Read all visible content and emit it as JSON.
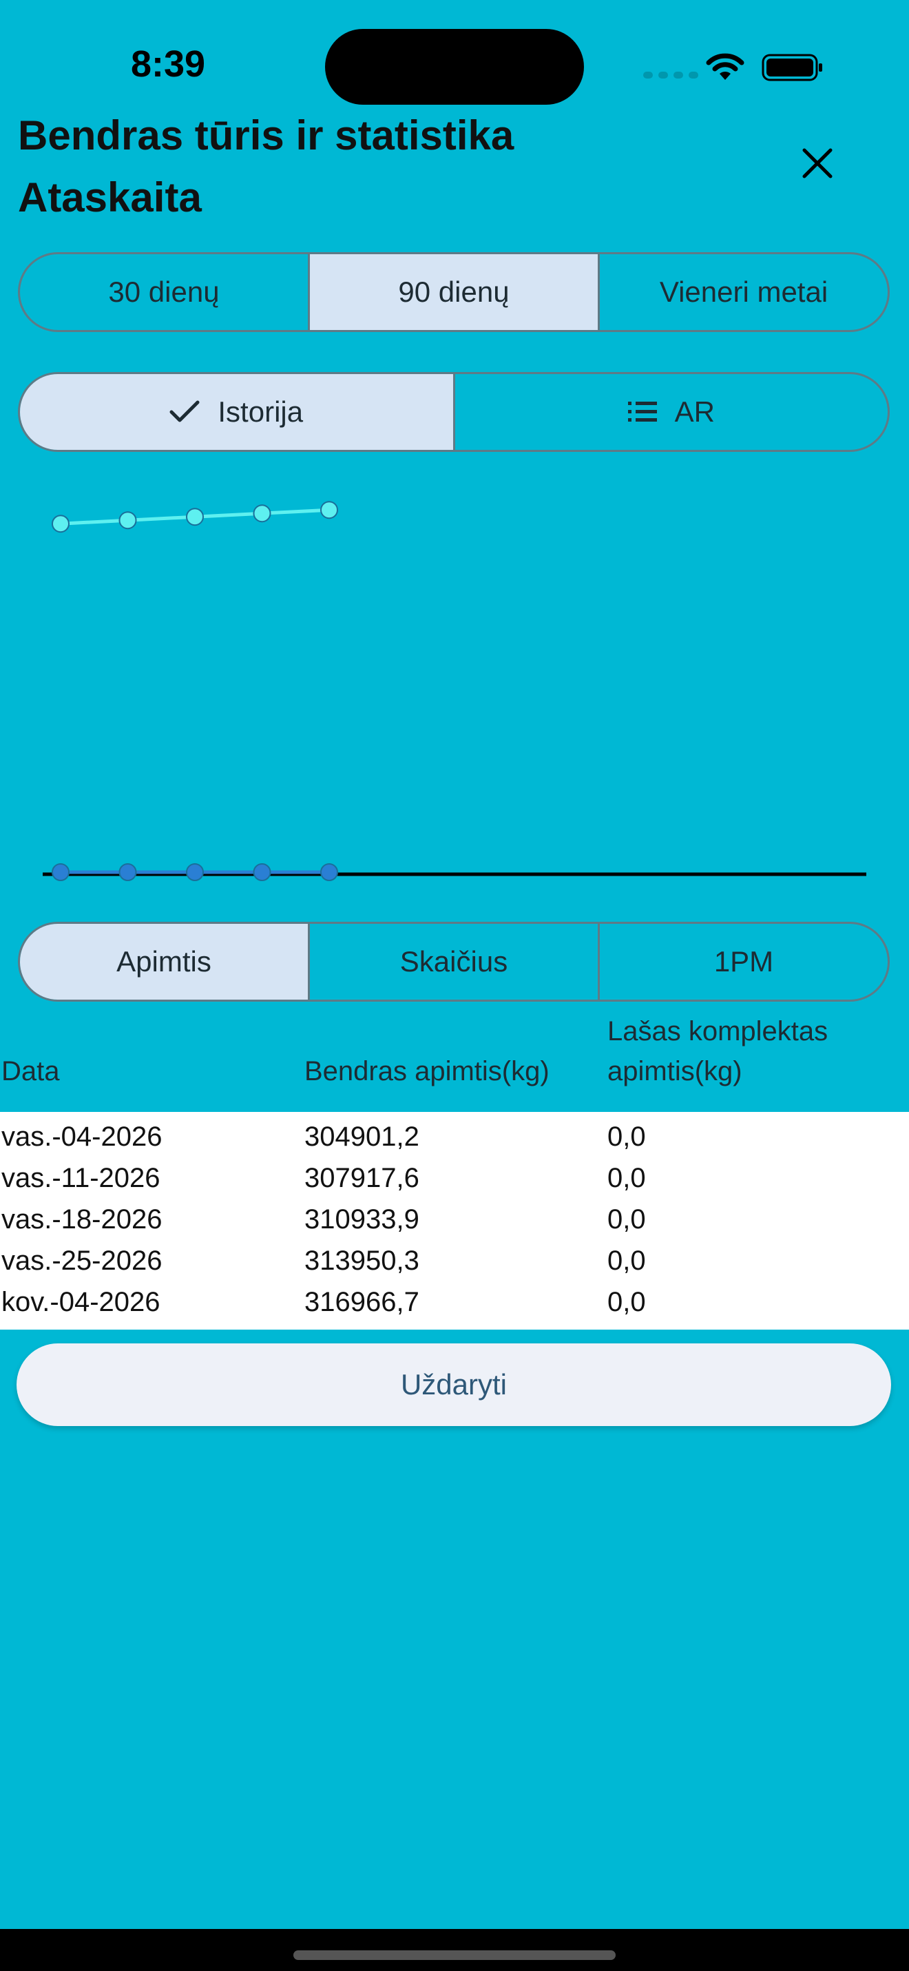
{
  "status_bar": {
    "time": "8:39"
  },
  "header": {
    "title_line1": "Bendras tūris ir statistika",
    "title_line2": "Ataskaita"
  },
  "period_tabs": [
    {
      "label": "30 dienų",
      "selected": false
    },
    {
      "label": "90 dienų",
      "selected": true
    },
    {
      "label": "Vieneri metai",
      "selected": false
    }
  ],
  "view_tabs": [
    {
      "label": "Istorija",
      "icon": "checkmark-icon",
      "selected": true
    },
    {
      "label": "AR",
      "icon": "list-icon",
      "selected": false
    }
  ],
  "metric_tabs": [
    {
      "label": "Apimtis",
      "selected": true
    },
    {
      "label": "Skaičius",
      "selected": false
    },
    {
      "label": "1PM",
      "selected": false
    }
  ],
  "chart_data": {
    "type": "line",
    "categories": [
      "vas.-04-2026",
      "vas.-11-2026",
      "vas.-18-2026",
      "vas.-25-2026",
      "kov.-04-2026"
    ],
    "series": [
      {
        "values": [
          304901.2,
          307917.6,
          310933.9,
          313950.3,
          316966.7
        ],
        "color": "#5ef0f0"
      },
      {
        "values": [
          0.0,
          0.0,
          0.0,
          0.0,
          0.0
        ],
        "color": "#2a7fd4"
      }
    ],
    "grid": false,
    "x_slots": 13
  },
  "table": {
    "headers": [
      "Data",
      "Bendras apimtis(kg)",
      "Lašas komplektas apimtis(kg)"
    ],
    "rows": [
      [
        "vas.-04-2026",
        "304901,2",
        "0,0"
      ],
      [
        "vas.-11-2026",
        "307917,6",
        "0,0"
      ],
      [
        "vas.-18-2026",
        "310933,9",
        "0,0"
      ],
      [
        "vas.-25-2026",
        "313950,3",
        "0,0"
      ],
      [
        "kov.-04-2026",
        "316966,7",
        "0,0"
      ]
    ]
  },
  "close_button_label": "Uždaryti",
  "colors": {
    "background": "#00b8d4",
    "selected_segment": "#d6e4f4",
    "segment_border": "#5f7a86"
  }
}
